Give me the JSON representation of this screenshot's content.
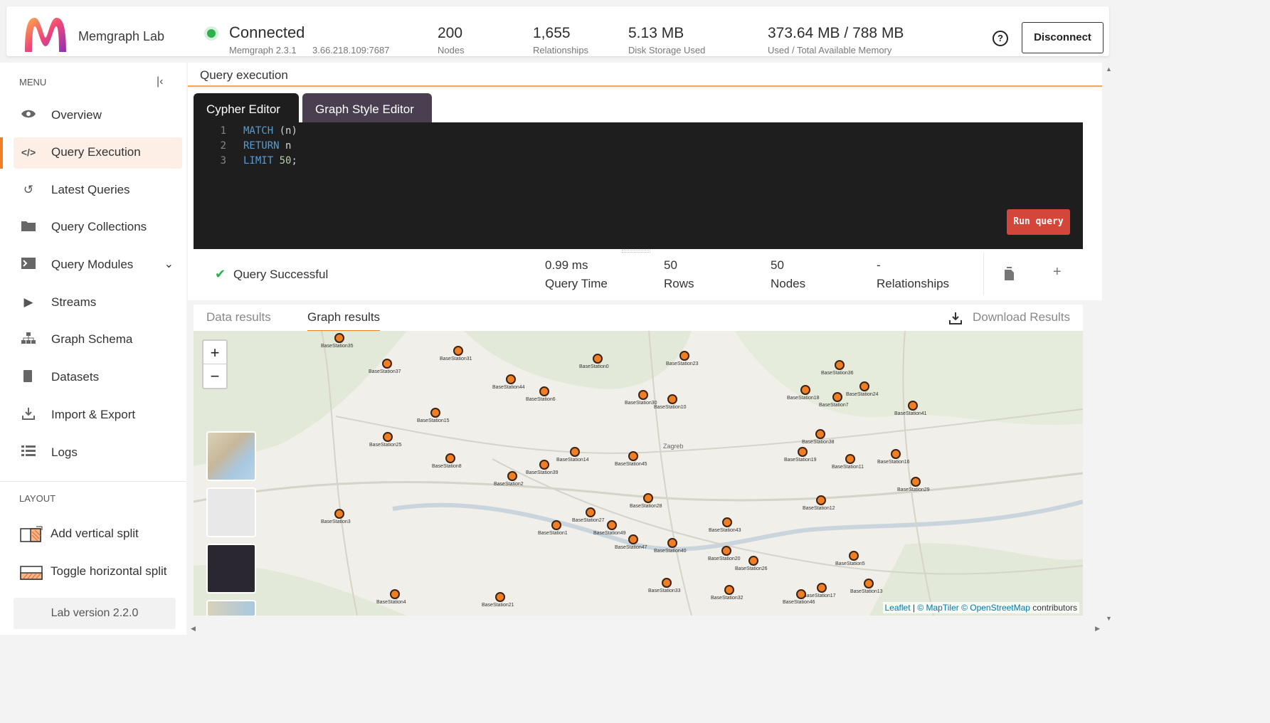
{
  "app": {
    "title": "Memgraph Lab"
  },
  "connection": {
    "status": "Connected",
    "version": "Memgraph 2.3.1",
    "address": "3.66.218.109:7687",
    "status_color": "#2bb24c"
  },
  "stats": [
    {
      "value": "200",
      "label": "Nodes"
    },
    {
      "value": "1,655",
      "label": "Relationships"
    },
    {
      "value": "5.13 MB",
      "label": "Disk Storage Used"
    },
    {
      "value": "373.64 MB / 788 MB",
      "label": "Used / Total Available Memory"
    }
  ],
  "header": {
    "disconnect_label": "Disconnect",
    "help_icon": "question-circle-icon"
  },
  "sidebar": {
    "menu_header": "MENU",
    "items": [
      {
        "label": "Overview",
        "icon": "eye-icon"
      },
      {
        "label": "Query Execution",
        "icon": "code-icon"
      },
      {
        "label": "Latest Queries",
        "icon": "history-icon"
      },
      {
        "label": "Query Collections",
        "icon": "folder-icon"
      },
      {
        "label": "Query Modules",
        "icon": "terminal-icon"
      },
      {
        "label": "Streams",
        "icon": "play-icon"
      },
      {
        "label": "Graph Schema",
        "icon": "hierarchy-icon"
      },
      {
        "label": "Datasets",
        "icon": "book-icon"
      },
      {
        "label": "Import & Export",
        "icon": "download-icon"
      },
      {
        "label": "Logs",
        "icon": "list-icon"
      }
    ],
    "layout_header": "LAYOUT",
    "layout_items": [
      {
        "label": "Add vertical split"
      },
      {
        "label": "Toggle horizontal split"
      }
    ],
    "version": "Lab version 2.2.0"
  },
  "main": {
    "title": "Query execution",
    "tabs": [
      {
        "label": "Cypher Editor"
      },
      {
        "label": "Graph Style Editor"
      }
    ],
    "code_lines": [
      {
        "num": "1",
        "kw": "MATCH",
        "rest": " (n)"
      },
      {
        "num": "2",
        "kw": "RETURN",
        "rest": " n"
      },
      {
        "num": "3",
        "kw": "LIMIT",
        "num_val": "50",
        "rest": ";"
      }
    ],
    "run_label": "Run query"
  },
  "result": {
    "status": "Query Successful",
    "metrics": [
      {
        "value": "0.99 ms",
        "label": "Query Time"
      },
      {
        "value": "50",
        "label": "Rows"
      },
      {
        "value": "50",
        "label": "Nodes"
      },
      {
        "value": "-",
        "label": "Relationships"
      }
    ],
    "tabs": [
      {
        "label": "Data results"
      },
      {
        "label": "Graph results"
      }
    ],
    "download_label": "Download Results"
  },
  "map": {
    "zoom_in": "+",
    "zoom_out": "−",
    "attribution": {
      "leaflet": "Leaflet",
      "sep": " | ",
      "maptiler": "© MapTiler",
      "osm": "© OpenStreetMap",
      "contributors": " contributors"
    },
    "place_label": "Zagreb",
    "nodes": [
      {
        "label": "BaseStation35"
      },
      {
        "label": "BaseStation31"
      },
      {
        "label": "BaseStation0"
      },
      {
        "label": "BaseStation23"
      },
      {
        "label": "BaseStation37"
      },
      {
        "label": "BaseStation44"
      },
      {
        "label": "BaseStation6"
      },
      {
        "label": "BaseStation30"
      },
      {
        "label": "BaseStation10"
      },
      {
        "label": "BaseStation36"
      },
      {
        "label": "BaseStation24"
      },
      {
        "label": "BaseStation18"
      },
      {
        "label": "BaseStation7"
      },
      {
        "label": "BaseStation41"
      },
      {
        "label": "BaseStation15"
      },
      {
        "label": "BaseStation25"
      },
      {
        "label": "BaseStation38"
      },
      {
        "label": "BaseStation19"
      },
      {
        "label": "BaseStation11"
      },
      {
        "label": "BaseStation16"
      },
      {
        "label": "BaseStation8"
      },
      {
        "label": "BaseStation14"
      },
      {
        "label": "BaseStation45"
      },
      {
        "label": "BaseStation39"
      },
      {
        "label": "BaseStation2"
      },
      {
        "label": "BaseStation29"
      },
      {
        "label": "BaseStation28"
      },
      {
        "label": "BaseStation12"
      },
      {
        "label": "BaseStation3"
      },
      {
        "label": "BaseStation27"
      },
      {
        "label": "BaseStation1"
      },
      {
        "label": "BaseStation49"
      },
      {
        "label": "BaseStation47"
      },
      {
        "label": "BaseStation40"
      },
      {
        "label": "BaseStation43"
      },
      {
        "label": "BaseStation20"
      },
      {
        "label": "BaseStation26"
      },
      {
        "label": "BaseStation5"
      },
      {
        "label": "BaseStation33"
      },
      {
        "label": "BaseStation32"
      },
      {
        "label": "BaseStation17"
      },
      {
        "label": "BaseStation46"
      },
      {
        "label": "BaseStation13"
      },
      {
        "label": "BaseStation4"
      },
      {
        "label": "BaseStation21"
      }
    ]
  },
  "colors": {
    "accent": "#f07e22",
    "run_button": "#d4453a",
    "success": "#2bb24c"
  }
}
